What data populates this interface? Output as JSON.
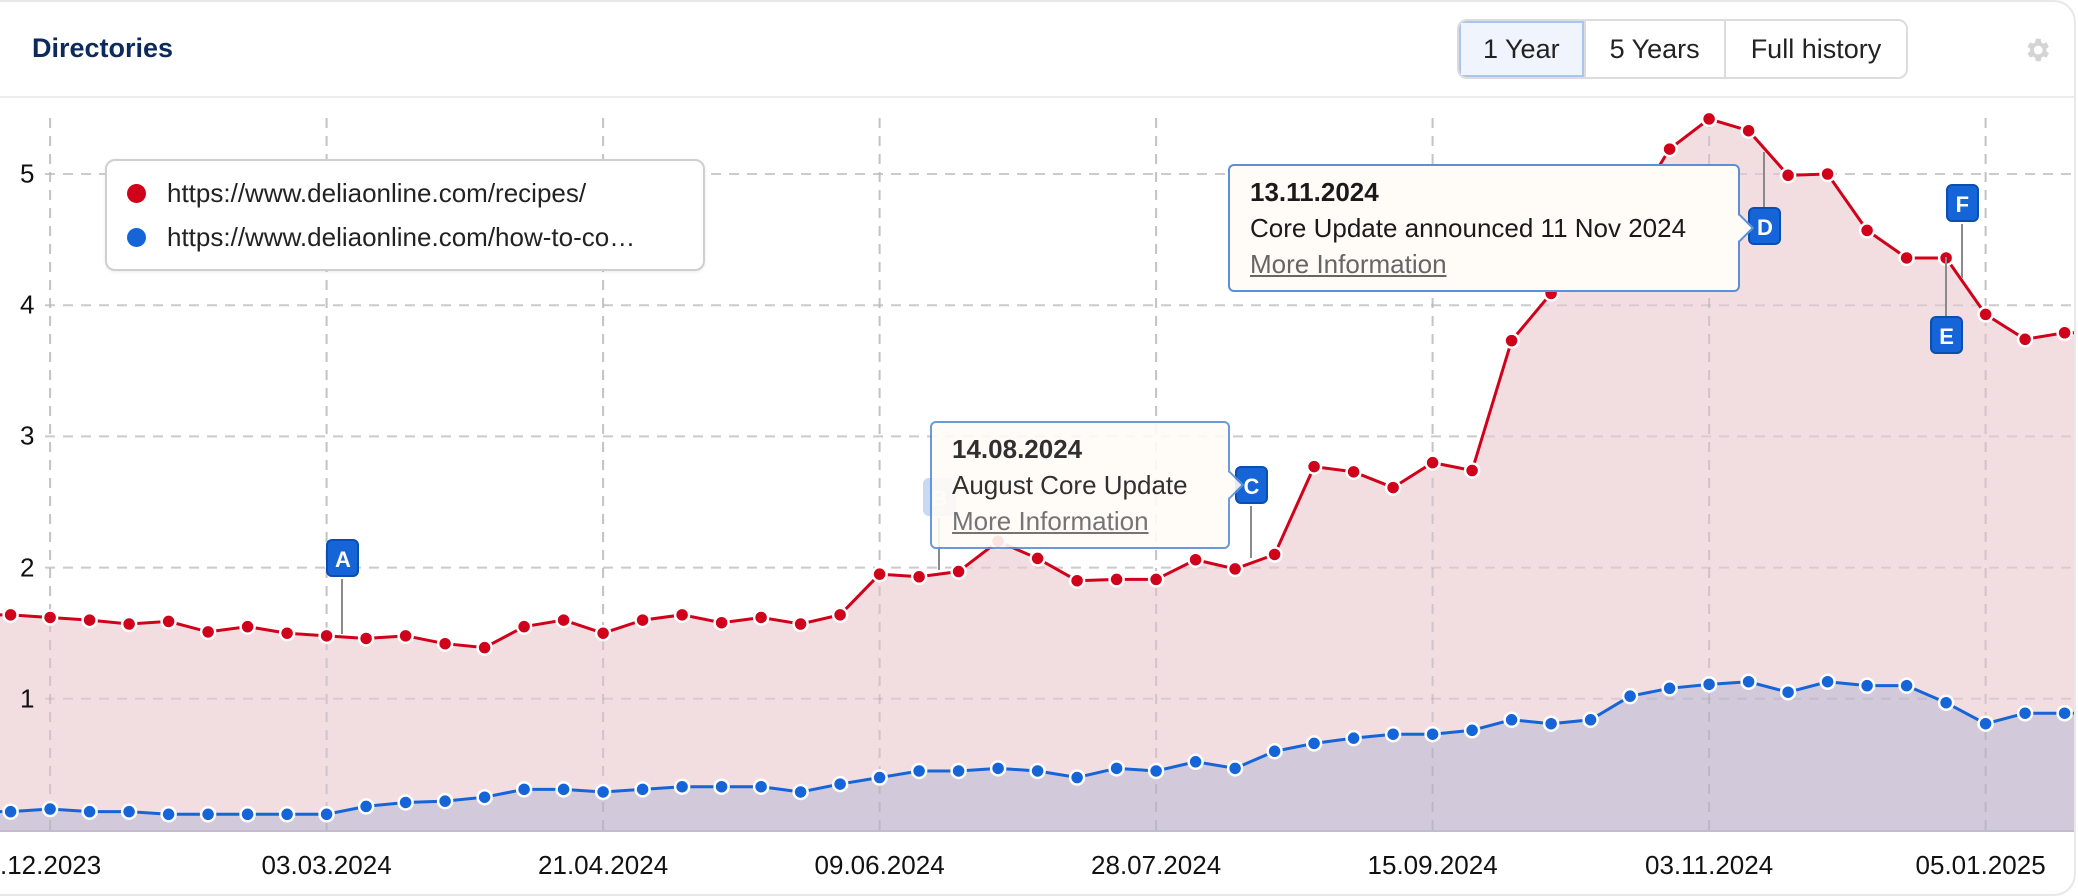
{
  "header": {
    "title": "Directories",
    "range_buttons": [
      {
        "label": "1 Year",
        "active": true
      },
      {
        "label": "5 Years",
        "active": false
      },
      {
        "label": "Full history",
        "active": false
      }
    ],
    "settings_icon": "gear-icon"
  },
  "legend": {
    "items": [
      {
        "label": "https://www.deliaonline.com/recipes/",
        "color": "#d0021b"
      },
      {
        "label": "https://www.deliaonline.com/how-to-co…",
        "color": "#1565d8"
      }
    ]
  },
  "annotations": {
    "flags": [
      "A",
      "B",
      "C",
      "D",
      "E",
      "F"
    ],
    "tooltip_b": {
      "date": "14.08.2024",
      "text": "August Core Update",
      "link": "More Information"
    },
    "tooltip_d": {
      "date": "13.11.2024",
      "text": "Core Update announced 11 Nov 2024",
      "link": "More Information"
    }
  },
  "chart_data": {
    "type": "area",
    "title": "Directories",
    "xlabel": "",
    "ylabel": "",
    "ylim": [
      0,
      5.5
    ],
    "yticks": [
      1,
      2,
      3,
      4,
      5
    ],
    "grid": true,
    "legend_position": "top-left",
    "x_tick_labels": [
      ".12.2023",
      "03.03.2024",
      "21.04.2024",
      "09.06.2024",
      "28.07.2024",
      "15.09.2024",
      "03.11.2024",
      "05.01.2025"
    ],
    "x_tick_point_index": [
      1,
      8,
      15,
      22,
      29,
      36,
      43,
      50
    ],
    "annotation_point_index": {
      "A": 8.4,
      "B": 23.5,
      "C": 31.4,
      "D": 44.4,
      "E": 49,
      "F": 49.4
    },
    "series": [
      {
        "name": "https://www.deliaonline.com/recipes/",
        "color": "#d0021b",
        "fill": "#f2dde0",
        "values": [
          1.64,
          1.62,
          1.6,
          1.57,
          1.59,
          1.51,
          1.55,
          1.5,
          1.48,
          1.46,
          1.48,
          1.42,
          1.39,
          1.55,
          1.6,
          1.5,
          1.6,
          1.64,
          1.58,
          1.62,
          1.57,
          1.64,
          1.95,
          1.93,
          1.97,
          2.2,
          2.07,
          1.9,
          1.91,
          1.91,
          2.06,
          1.99,
          2.1,
          2.77,
          2.73,
          2.61,
          2.8,
          2.74,
          3.73,
          4.09,
          4.9,
          4.7,
          5.19,
          5.42,
          5.33,
          4.99,
          5.0,
          4.57,
          4.36,
          4.36,
          3.93,
          3.74,
          3.79
        ]
      },
      {
        "name": "https://www.deliaonline.com/how-to-co…",
        "color": "#1565d8",
        "fill": "#d0c8da",
        "values": [
          0.14,
          0.16,
          0.14,
          0.14,
          0.12,
          0.12,
          0.12,
          0.12,
          0.12,
          0.18,
          0.21,
          0.22,
          0.25,
          0.31,
          0.31,
          0.29,
          0.31,
          0.33,
          0.33,
          0.33,
          0.29,
          0.35,
          0.4,
          0.45,
          0.45,
          0.47,
          0.45,
          0.4,
          0.47,
          0.45,
          0.52,
          0.47,
          0.6,
          0.66,
          0.7,
          0.73,
          0.73,
          0.76,
          0.84,
          0.81,
          0.84,
          1.02,
          1.08,
          1.11,
          1.13,
          1.05,
          1.13,
          1.1,
          1.1,
          0.97,
          0.81,
          0.89,
          0.89
        ]
      }
    ]
  }
}
